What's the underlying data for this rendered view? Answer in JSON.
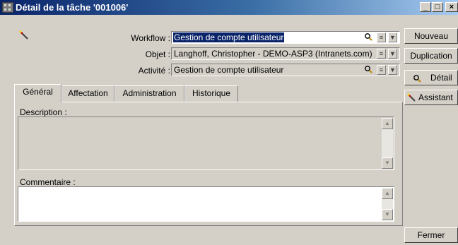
{
  "window": {
    "title": "Détail de la tâche '001006'",
    "controls": {
      "minimize": "_",
      "maximize": "□",
      "close": "×"
    }
  },
  "form": {
    "workflow": {
      "label": "Workflow :",
      "value": "Gestion de compte utilisateur"
    },
    "objet": {
      "label": "Objet :",
      "value": "Langhoff, Christopher - DEMO-ASP3 (Intranets.com)"
    },
    "activite": {
      "label": "Activité :",
      "value": "Gestion de compte utilisateur"
    }
  },
  "tabs": [
    {
      "label": "Général",
      "active": true
    },
    {
      "label": "Affectation",
      "active": false
    },
    {
      "label": "Administration",
      "active": false
    },
    {
      "label": "Historique",
      "active": false
    }
  ],
  "general": {
    "description_label": "Description :",
    "commentaire_label": "Commentaire :"
  },
  "buttons": {
    "nouveau": "Nouveau",
    "duplication": "Duplication",
    "detail": "Détail",
    "assistant": "Assistant",
    "fermer": "Fermer"
  },
  "icons": {
    "wizard": "wand-icon",
    "zoom": "magnifier-icon",
    "list": "list-icon",
    "dropdown": "chevron-down-icon"
  },
  "colors": {
    "titlebar": "#0a246a",
    "face": "#d4d0c8",
    "selection": "#0a246a"
  }
}
